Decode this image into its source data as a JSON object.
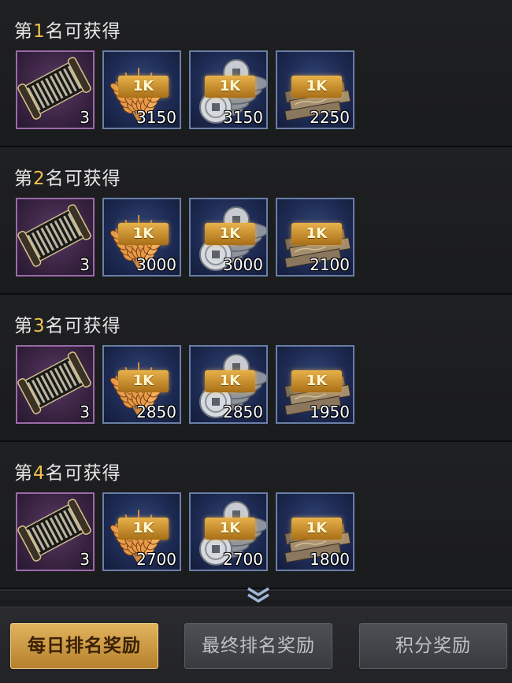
{
  "rewards": [
    {
      "title_prefix": "第",
      "rank": "1",
      "title_suffix": "名可获得",
      "items": [
        {
          "type": "scroll",
          "icon": "scroll-icon",
          "count": "3"
        },
        {
          "type": "grain",
          "icon": "grain-icon",
          "badge": "1K",
          "count": "3150"
        },
        {
          "type": "coins",
          "icon": "coins-icon",
          "badge": "1K",
          "count": "3150"
        },
        {
          "type": "cloth",
          "icon": "cloth-icon",
          "badge": "1K",
          "count": "2250"
        }
      ]
    },
    {
      "title_prefix": "第",
      "rank": "2",
      "title_suffix": "名可获得",
      "items": [
        {
          "type": "scroll",
          "icon": "scroll-icon",
          "count": "3"
        },
        {
          "type": "grain",
          "icon": "grain-icon",
          "badge": "1K",
          "count": "3000"
        },
        {
          "type": "coins",
          "icon": "coins-icon",
          "badge": "1K",
          "count": "3000"
        },
        {
          "type": "cloth",
          "icon": "cloth-icon",
          "badge": "1K",
          "count": "2100"
        }
      ]
    },
    {
      "title_prefix": "第",
      "rank": "3",
      "title_suffix": "名可获得",
      "items": [
        {
          "type": "scroll",
          "icon": "scroll-icon",
          "count": "3"
        },
        {
          "type": "grain",
          "icon": "grain-icon",
          "badge": "1K",
          "count": "2850"
        },
        {
          "type": "coins",
          "icon": "coins-icon",
          "badge": "1K",
          "count": "2850"
        },
        {
          "type": "cloth",
          "icon": "cloth-icon",
          "badge": "1K",
          "count": "1950"
        }
      ]
    },
    {
      "title_prefix": "第",
      "rank": "4",
      "title_suffix": "名可获得",
      "items": [
        {
          "type": "scroll",
          "icon": "scroll-icon",
          "count": "3"
        },
        {
          "type": "grain",
          "icon": "grain-icon",
          "badge": "1K",
          "count": "2700"
        },
        {
          "type": "coins",
          "icon": "coins-icon",
          "badge": "1K",
          "count": "2700"
        },
        {
          "type": "cloth",
          "icon": "cloth-icon",
          "badge": "1K",
          "count": "1800"
        }
      ]
    }
  ],
  "tabs": [
    {
      "label": "每日排名奖励",
      "active": true
    },
    {
      "label": "最终排名奖励",
      "active": false
    },
    {
      "label": "积分奖励",
      "active": false
    }
  ],
  "colors": {
    "rank_number": "#f2c24e",
    "item_border": "#6a7fa6",
    "scroll_border": "#9b6aa8",
    "active_tab": "#e2b35e"
  }
}
